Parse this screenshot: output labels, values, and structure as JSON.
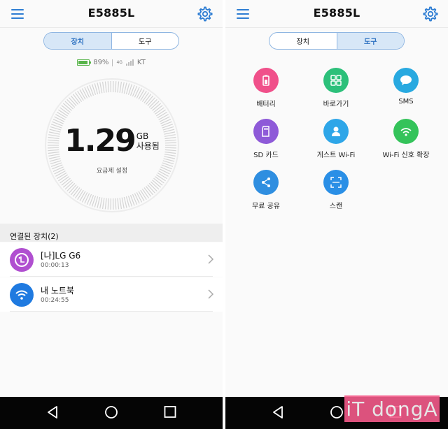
{
  "left": {
    "title": "E5885L",
    "tabs": [
      {
        "label": "장치",
        "active": true
      },
      {
        "label": "도구",
        "active": false
      }
    ],
    "status": {
      "battery": "89%",
      "network": "4G",
      "carrier": "KT"
    },
    "usage": {
      "value": "1.29",
      "unit": "GB",
      "label": "사용됨"
    },
    "plan_setting": "요금제 설정",
    "connected_header": "연결된 장치(2)",
    "devices": [
      {
        "name": "[나]LG G6",
        "time": "00:00:13",
        "color": "#b04fd0",
        "icon": "lg-icon"
      },
      {
        "name": "내 노트북",
        "time": "00:24:55",
        "color": "#1f7ae0",
        "icon": "wifi-icon"
      }
    ]
  },
  "right": {
    "title": "E5885L",
    "tabs": [
      {
        "label": "장치",
        "active": false
      },
      {
        "label": "도구",
        "active": true
      }
    ],
    "tools": [
      {
        "label": "배터리",
        "color": "#f0508a",
        "icon": "battery-icon"
      },
      {
        "label": "바로가기",
        "color": "#2cc07a",
        "icon": "shortcut-icon"
      },
      {
        "label": "SMS",
        "color": "#28a9e0",
        "icon": "sms-icon"
      },
      {
        "label": "SD 카드",
        "color": "#8e5ad8",
        "icon": "sd-card-icon"
      },
      {
        "label": "게스트 Wi-Fi",
        "color": "#2ea6e8",
        "icon": "guest-wifi-icon"
      },
      {
        "label": "Wi-Fi 신호 확장",
        "color": "#34c35a",
        "icon": "wifi-extend-icon"
      },
      {
        "label": "무료 공유",
        "color": "#2f8ee0",
        "icon": "share-icon"
      },
      {
        "label": "스캔",
        "color": "#2a8fe6",
        "icon": "scan-icon"
      }
    ]
  },
  "watermark": "iT dongA",
  "colors": {
    "accent": "#2e7dd3",
    "tab_active_bg": "#d7e7f7"
  }
}
